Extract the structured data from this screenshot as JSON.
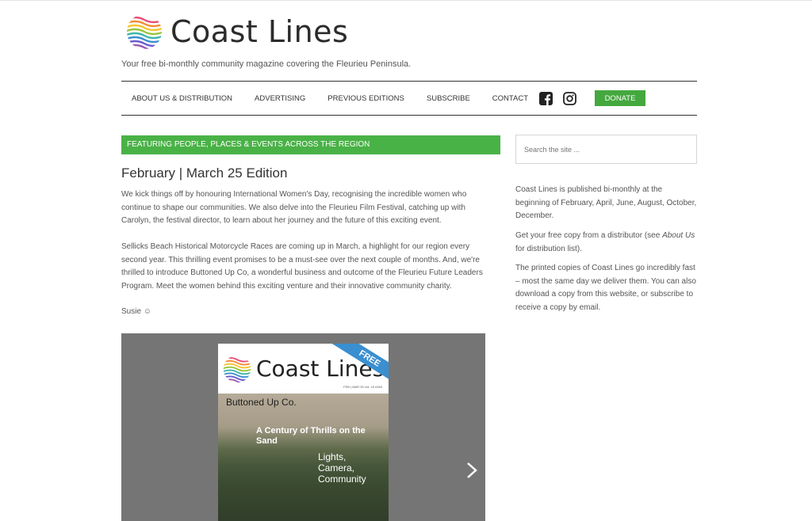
{
  "site": {
    "title": "Coast Lines",
    "tagline": "Your free bi-monthly community magazine covering the Fleurieu Peninsula."
  },
  "nav": {
    "items": [
      {
        "label": "ABOUT US & DISTRIBUTION"
      },
      {
        "label": "ADVERTISING"
      },
      {
        "label": "PREVIOUS EDITIONS"
      },
      {
        "label": "SUBSCRIBE"
      },
      {
        "label": "CONTACT"
      }
    ],
    "facebook_icon": "facebook-icon",
    "instagram_icon": "instagram-icon",
    "donate_label": "DONATE",
    "accent_color": "#44a83e"
  },
  "main": {
    "feature_banner": "FEATURING PEOPLE, PLACES & EVENTS ACROSS THE REGION",
    "edition_title": "February | March 25 Edition",
    "paragraph1": "We kick things off by honouring International Women's Day, recognising the incredible women who continue to shape our communities. We also delve into the Fleurieu Film Festival, catching up with Carolyn, the festival director, to learn about her journey and the future of this exciting event.",
    "paragraph2": "Sellicks Beach Historical Motorcycle Races are coming up in March, a highlight for our region every second year. This thrilling event promises to be a must-see over the next couple of months. And, we're thrilled to introduce Buttoned Up Co, a wonderful business and outcome of the Fleurieu Future Leaders Program. Meet the women behind this exciting venture and their innovative community charity.",
    "signature": "Susie ☺"
  },
  "slider": {
    "cover_title": "Coast Lines",
    "free_label": "FREE",
    "issue_line": "FEB | MAR 25 Vol. 19 #163",
    "headline1": "Buttoned Up Co.",
    "headline2": "A Century of Thrills on the Sand",
    "headline3": "Lights, Camera, Community",
    "next_icon": "chevron-right-icon"
  },
  "sidebar": {
    "search_placeholder": "Search the site ...",
    "para1": "Coast Lines is published bi-monthly at the beginning of February, April, June, August, October, December.",
    "para2_pre": "Get your free copy from a distributor (see ",
    "para2_link1": "About Us",
    "para2_link2": "for distribution list",
    "para2_post": ").",
    "para3_pre": "The printed copies of Coast Lines go incredibly fast – most the same day we deliver them. You can also download a copy from this website, or ",
    "para3_link": "subscribe",
    "para3_post": " to receive a copy by email."
  }
}
